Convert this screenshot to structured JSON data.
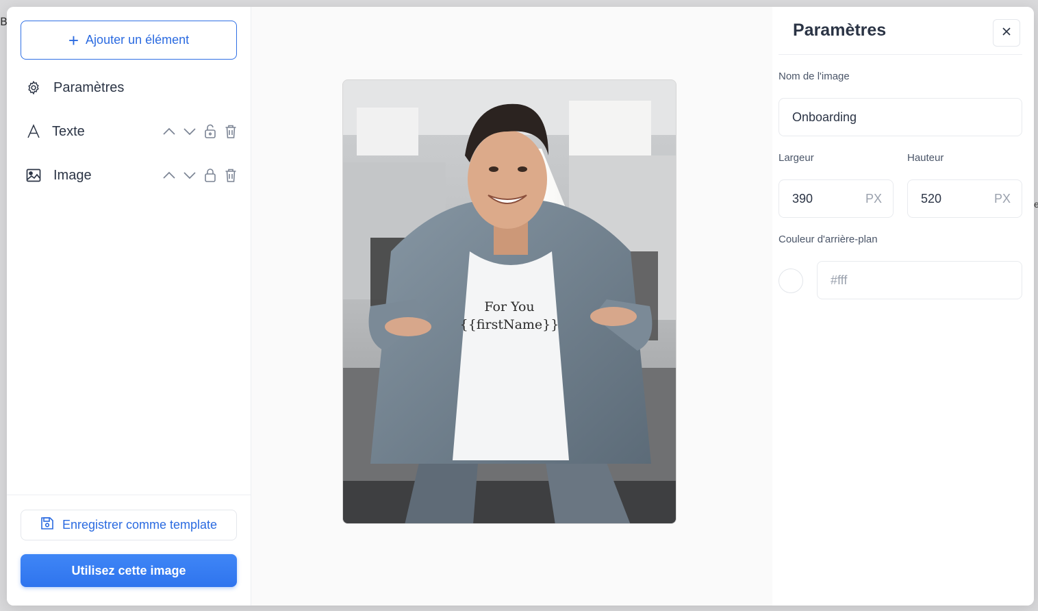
{
  "background_peek": {
    "left_char": "B",
    "right_char": "e"
  },
  "sidebar": {
    "add_button": {
      "label": "Ajouter un élément",
      "icon": "plus-icon"
    },
    "items": [
      {
        "label": "Paramètres",
        "icon": "gear-icon"
      },
      {
        "label": "Texte",
        "icon": "text-icon"
      },
      {
        "label": "Image",
        "icon": "image-icon"
      }
    ],
    "save_template_button": {
      "label": "Enregistrer comme template",
      "icon": "floppy-disk-icon"
    },
    "use_image_button": {
      "label": "Utilisez cette image"
    }
  },
  "canvas": {
    "shirt_text_line1": "For You",
    "shirt_text_line2": "{{firstName}}"
  },
  "panel": {
    "title": "Paramètres",
    "image_name": {
      "label": "Nom de l'image",
      "value": "Onboarding"
    },
    "width": {
      "label": "Largeur",
      "value": "390",
      "unit": "PX"
    },
    "height": {
      "label": "Hauteur",
      "value": "520",
      "unit": "PX"
    },
    "background_color": {
      "label": "Couleur d'arrière-plan",
      "placeholder": "#fff",
      "swatch": "#ffffff"
    }
  },
  "colors": {
    "accent": "#2f6fe4",
    "primary_button": "#3b82f6",
    "text": "#2b3445"
  }
}
